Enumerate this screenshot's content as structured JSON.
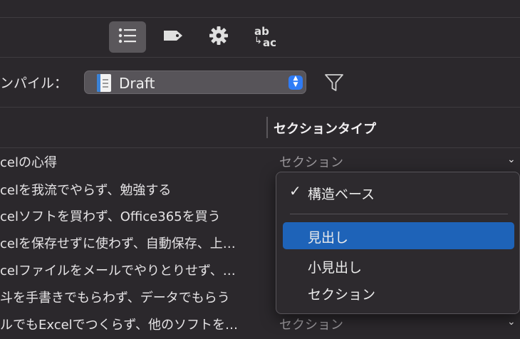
{
  "toolbar": {
    "icons": [
      "list-icon",
      "tag-icon",
      "gear-icon",
      "text-replace-icon"
    ],
    "replace_top": "ab",
    "replace_bottom": "ac"
  },
  "compile": {
    "label": "ンパイル：",
    "format_value": "Draft"
  },
  "columns": {
    "section_type": "セクションタイプ"
  },
  "rows": [
    {
      "title": "celの心得",
      "type": "セクション"
    },
    {
      "title": "celを我流でやらず、勉強する",
      "type": ""
    },
    {
      "title": "celソフトを買わず、Office365を買う",
      "type": ""
    },
    {
      "title": "celを保存せずに使わず、自動保存、上…",
      "type": ""
    },
    {
      "title": "celファイルをメールでやりとりせず、…",
      "type": ""
    },
    {
      "title": "斗を手書きでもらわず、データでもらう",
      "type": ""
    },
    {
      "title": "ルでもExcelでつくらず、他のソフトを…",
      "type": "セクション"
    }
  ],
  "menu": {
    "items": [
      {
        "label": "構造ベース",
        "checked": true,
        "selected": false
      },
      {
        "label": "見出し",
        "checked": false,
        "selected": true
      },
      {
        "label": "小見出し",
        "checked": false,
        "selected": false
      },
      {
        "label": "セクション",
        "checked": false,
        "selected": false
      }
    ],
    "check_glyph": "✓"
  },
  "colors": {
    "background": "#2b282c",
    "selection": "#1e63b8",
    "accent": "#2f7cf6"
  }
}
